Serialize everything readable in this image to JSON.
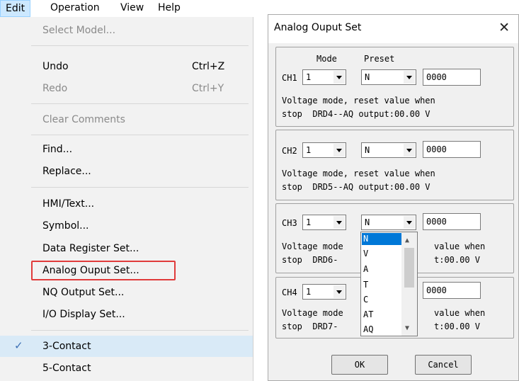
{
  "menubar": {
    "items": [
      "Edit",
      "Operation",
      "View",
      "Help"
    ]
  },
  "menu": {
    "select_model": "Select Model...",
    "undo": "Undo",
    "undo_shortcut": "Ctrl+Z",
    "redo": "Redo",
    "redo_shortcut": "Ctrl+Y",
    "clear_comments": "Clear Comments",
    "find": "Find...",
    "replace": "Replace...",
    "hmi_text": "HMI/Text...",
    "symbol": "Symbol...",
    "data_register_set": "Data Register Set...",
    "analog_output_set": "Analog Ouput Set...",
    "nq_output_set": "NQ Output Set...",
    "io_display_set": "I/O Display Set...",
    "three_contact": "3-Contact",
    "five_contact": "5-Contact",
    "check_mark": "✓"
  },
  "dialog": {
    "title": "Analog Ouput Set",
    "close": "✕",
    "header_mode": "Mode",
    "header_preset": "Preset",
    "channels": [
      {
        "label": "CH1",
        "mode": "1",
        "preset": "N",
        "value": "0000",
        "desc1": "Voltage mode, reset value when",
        "desc2": "stop  DRD4--AQ output:00.00 V"
      },
      {
        "label": "CH2",
        "mode": "1",
        "preset": "N",
        "value": "0000",
        "desc1": "Voltage mode, reset value when",
        "desc2": "stop  DRD5--AQ output:00.00 V"
      },
      {
        "label": "CH3",
        "mode": "1",
        "preset": "N",
        "value": "0000",
        "desc1_a": "Voltage mode",
        "desc1_b": "value when",
        "desc2_a": "stop  DRD6-",
        "desc2_b": "t:00.00 V"
      },
      {
        "label": "CH4",
        "mode": "1",
        "preset": "",
        "value": "0000",
        "desc1_a": "Voltage mode",
        "desc1_b": "value when",
        "desc2_a": "stop  DRD7-",
        "desc2_b": "t:00.00 V"
      }
    ],
    "preset_options": [
      "N",
      "V",
      "A",
      "T",
      "C",
      "AT",
      "AQ"
    ],
    "ok": "OK",
    "cancel": "Cancel"
  }
}
